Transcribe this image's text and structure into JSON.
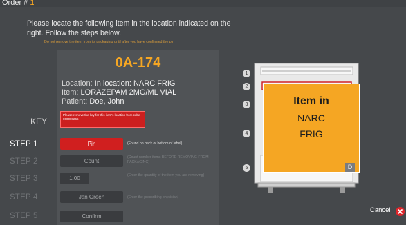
{
  "header": {
    "order_label": "Order #",
    "order_number": "1"
  },
  "instructions": {
    "main": "Please locate the following item in the location indicated on the right. Follow the steps below.",
    "warning": "Do not remove the item from its packaging until after you have confirmed the pin"
  },
  "item": {
    "code": "0A-174",
    "location_label": "Location:",
    "location_value": "In location: NARC FRIG",
    "item_label": "Item:",
    "item_value": "LORAZEPAM 2MG/ML VIAL",
    "patient_label": "Patient:",
    "patient_value": "Doe, John"
  },
  "key": {
    "label": "KEY",
    "note": "Please remove the key for this item's location from cube 000008266"
  },
  "steps": [
    {
      "label": "STEP 1",
      "button": "Pin",
      "desc": "(Found on back or bottom of label)"
    },
    {
      "label": "STEP 2",
      "button": "Count",
      "desc": "(Count number items BEFORE REMOVING FROM PACKAGING)"
    },
    {
      "label": "STEP 3",
      "button": "1.00",
      "desc": "(Enter the quantity of the item you are removing)"
    },
    {
      "label": "STEP 4",
      "button": "Jan Green",
      "desc": "(Enter the prescribing physician)"
    },
    {
      "label": "STEP 5",
      "button": "Confirm",
      "desc": ""
    }
  ],
  "cabinet": {
    "callout_line1": "Item in",
    "callout_line2": "NARC",
    "callout_line3": "FRIG",
    "drawer_numbers": [
      "1",
      "2",
      "3",
      "4",
      "5"
    ],
    "drawer_badge": "D"
  },
  "footer": {
    "cancel_label": "Cancel"
  },
  "colors": {
    "accent": "#f5a623",
    "alert": "#d01f1f",
    "background": "#45484b"
  }
}
